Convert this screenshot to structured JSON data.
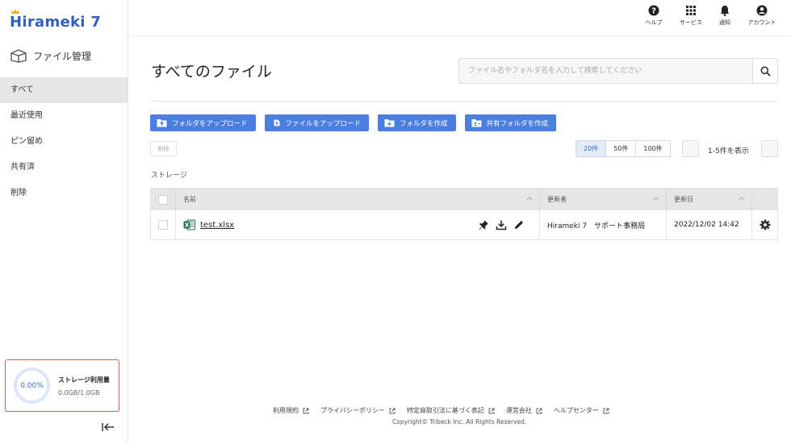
{
  "app": {
    "logo_text": "Hirameki 7",
    "section_title": "ファイル管理"
  },
  "sidebar": {
    "items": [
      {
        "label": "すべて",
        "active": true
      },
      {
        "label": "最近使用"
      },
      {
        "label": "ピン留め"
      },
      {
        "label": "共有済"
      },
      {
        "label": "削除"
      }
    ],
    "storage": {
      "percent_label": "0.00%",
      "label": "ストレージ利用量",
      "used": "0.0GB/1.0GB",
      "percent": 0
    }
  },
  "topbar": {
    "help": "ヘルプ",
    "services": "サービス",
    "notifications": "通知",
    "account": "アカウント"
  },
  "main": {
    "title": "すべてのファイル",
    "search_placeholder": "ファイル名やフォルダ名を入力して検索してください",
    "actions": {
      "upload_folder": "フォルダをアップロード",
      "upload_file": "ファイルをアップロード",
      "create_folder": "フォルダを作成",
      "create_shared_folder": "共有フォルダを作成"
    },
    "delete_label": "削除",
    "page_sizes": [
      "20件",
      "50件",
      "100件"
    ],
    "selected_page_size": "20件",
    "page_info": "1-5件を表示",
    "breadcrumb": "ストレージ",
    "table": {
      "headers": {
        "name": "名前",
        "updater": "更新者",
        "updated_at": "更新日"
      },
      "rows": [
        {
          "name": "test.xlsx",
          "updater": "Hirameki 7　サポート事務局",
          "updated_at": "2022/12/02 14:42"
        }
      ]
    }
  },
  "footer": {
    "links": [
      "利用規約",
      "プライバシーポリシー",
      "特定商取引法に基づく表記",
      "運営会社",
      "ヘルプセンター"
    ],
    "copyright": "Copyright© Tribeck Inc. All Rights Reserved."
  },
  "colors": {
    "accent": "#4a7fe0",
    "brand": "#2f5ec6",
    "storage_border": "#e05a5a",
    "excel_green": "#1d7044"
  }
}
